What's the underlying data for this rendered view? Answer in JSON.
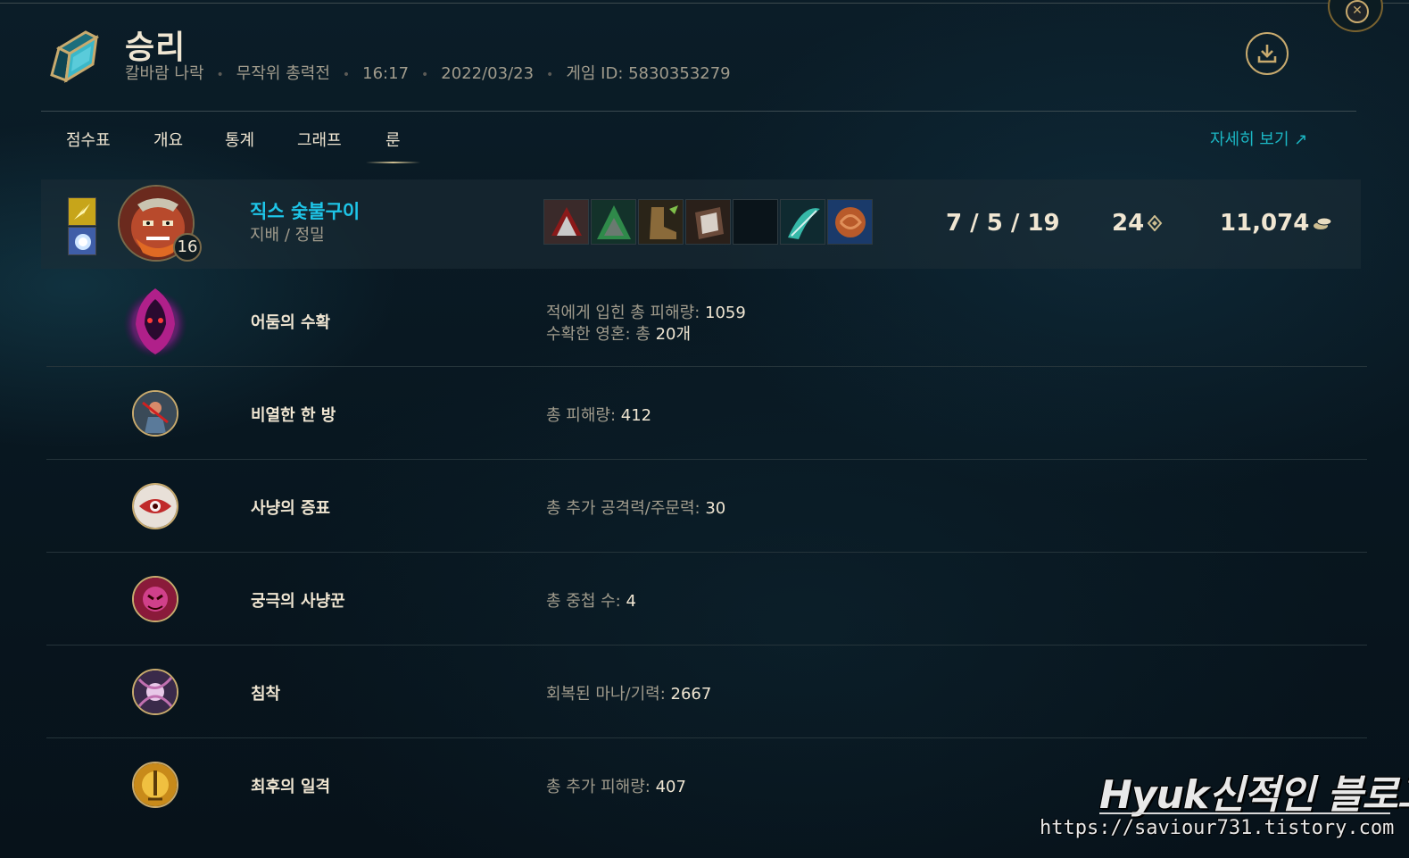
{
  "header": {
    "result": "승리",
    "map": "칼바람 나락",
    "mode": "무작위 총력전",
    "duration": "16:17",
    "date": "2022/03/23",
    "game_id": "게임 ID: 5830353279",
    "icons": {
      "mode": "aram-crystal-icon",
      "download": "download-icon",
      "close": "close-icon"
    }
  },
  "tabs": [
    {
      "label": "점수표"
    },
    {
      "label": "개요"
    },
    {
      "label": "통계"
    },
    {
      "label": "그래프"
    },
    {
      "label": "룬",
      "active": true
    }
  ],
  "detail_link": "자세히 보기 ↗",
  "player": {
    "name": "직스 숯불구이",
    "runes": "지배 / 정밀",
    "level": "16",
    "kda": "7 / 5 / 19",
    "cs": "24",
    "gold": "11,074",
    "spells": [
      "flash-icon",
      "mark-icon"
    ],
    "items": [
      "item-1-icon",
      "item-2-icon",
      "boots-icon",
      "item-4-icon",
      "empty-slot",
      "item-6-icon",
      "item-7-icon"
    ]
  },
  "runes": [
    {
      "name": "어둠의 수확",
      "stat1_label": "적에게 입힌 총 피해량: ",
      "stat1_value": "1059",
      "stat2_label": "수확한 영혼: 총 ",
      "stat2_value": "20개"
    },
    {
      "name": "비열한 한 방",
      "stat1_label": "총 피해량: ",
      "stat1_value": "412"
    },
    {
      "name": "사냥의 증표",
      "stat1_label": "총 추가 공격력/주문력: ",
      "stat1_value": "30"
    },
    {
      "name": "궁극의 사냥꾼",
      "stat1_label": "총 중첩 수: ",
      "stat1_value": "4"
    },
    {
      "name": "침착",
      "stat1_label": "회복된 마나/기력: ",
      "stat1_value": "2667"
    },
    {
      "name": "최후의 일격",
      "stat1_label": "총 추가 피해량: ",
      "stat1_value": "407"
    }
  ],
  "watermark": {
    "title": "Hyuk신적인 블로그",
    "url": "https://saviour731.tistory.com"
  },
  "colors": {
    "gold": "#c8aa6e",
    "cyan": "#1ec5e8",
    "text": "#f0e6d2",
    "muted": "#a09b8c"
  }
}
